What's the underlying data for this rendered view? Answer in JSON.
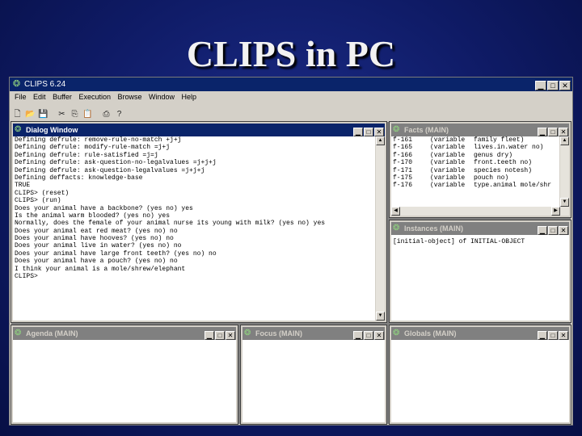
{
  "slide": {
    "title": "CLIPS in PC"
  },
  "app": {
    "title": "CLIPS 6.24",
    "menu": [
      "File",
      "Edit",
      "Buffer",
      "Execution",
      "Browse",
      "Window",
      "Help"
    ]
  },
  "dialog": {
    "title": "Dialog Window",
    "lines": [
      "Defining defrule: remove-rule-no-match +j+j",
      "Defining defrule: modify-rule-match =j+j",
      "Defining defrule: rule-satisfied =j=j",
      "Defining defrule: ask-question-no-legalvalues =j+j+j",
      "Defining defrule: ask-question-legalvalues =j+j+j",
      "Defining deffacts: knowledge-base",
      "TRUE",
      "CLIPS> (reset)",
      "CLIPS> (run)",
      "Does your animal have a backbone? (yes no) yes",
      "Is the animal warm blooded? (yes no) yes",
      "Normally, does the female of your animal nurse its young with milk? (yes no) yes",
      "Does your animal eat red meat? (yes no) no",
      "Does your animal have hooves? (yes no) no",
      "Does your animal live in water? (yes no) no",
      "Does your animal have large front teeth? (yes no) no",
      "Does your animal have a pouch? (yes no) no",
      "I think your animal is a mole/shrew/elephant",
      "CLIPS>"
    ]
  },
  "facts": {
    "title": "Facts (MAIN)",
    "rows": [
      {
        "id": "f-161",
        "c": "(variable",
        "v": "family fleet)"
      },
      {
        "id": "f-165",
        "c": "(variable",
        "v": "lives.in.water no)"
      },
      {
        "id": "f-166",
        "c": "(variable",
        "v": "genus dry)"
      },
      {
        "id": "f-170",
        "c": "(variable",
        "v": "front.teeth no)"
      },
      {
        "id": "f-171",
        "c": "(variable",
        "v": "species notesh)"
      },
      {
        "id": "f-175",
        "c": "(variable",
        "v": "pouch no)"
      },
      {
        "id": "f-176",
        "c": "(variable",
        "v": "type.animal mole/shr"
      }
    ]
  },
  "instances": {
    "title": "Instances (MAIN)",
    "lines": [
      "[initial-object] of INITIAL-OBJECT"
    ]
  },
  "agenda": {
    "title": "Agenda (MAIN)"
  },
  "focus": {
    "title": "Focus (MAIN)"
  },
  "globals": {
    "title": "Globals (MAIN)"
  }
}
